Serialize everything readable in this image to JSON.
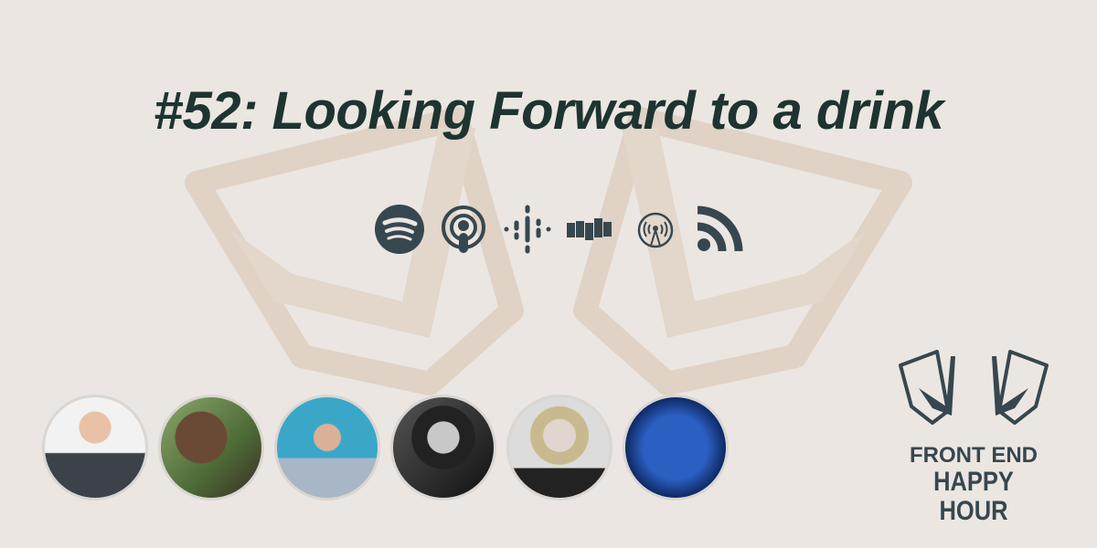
{
  "episode": {
    "title": "#52: Looking Forward to a drink"
  },
  "platforms": [
    {
      "name": "Spotify",
      "icon": "spotify-icon"
    },
    {
      "name": "Apple Podcasts",
      "icon": "apple-podcasts-icon"
    },
    {
      "name": "Google Podcasts",
      "icon": "google-podcasts-icon"
    },
    {
      "name": "Stitcher",
      "icon": "stitcher-icon"
    },
    {
      "name": "Overcast",
      "icon": "overcast-icon"
    },
    {
      "name": "RSS",
      "icon": "rss-icon"
    }
  ],
  "logo": {
    "line1": "FRONT END",
    "line2": "HAPPY HOUR"
  },
  "colors": {
    "background": "#ebe6e1",
    "title": "#1d3431",
    "icon": "#37474f",
    "watermark": "#e0d2c5"
  }
}
